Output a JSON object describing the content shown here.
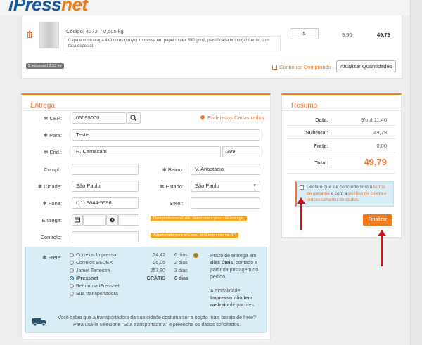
{
  "header": {
    "logo_main": "iPress",
    "logo_accent": "net"
  },
  "cart": {
    "product_code": "Código: 4272 – 0,505 kg",
    "product_description": "Capa e contracapa 4x0 cores (cmyk) impressa em papel triplex 350 g/m2, plastificada brilho (só frente) com faca especial.",
    "quantity": "5",
    "unit_price": "9,96",
    "total_price": "49,79",
    "volumes_badge": "5 volumes | 2,53 kg",
    "continue_label": "Continuar Comprando",
    "update_label": "Atualizar Quantidades",
    "icons": {
      "trash": "trash-icon",
      "cart": "cart-icon"
    }
  },
  "entrega": {
    "title": "Entrega",
    "cep_label": "CEP:",
    "cep_value": "05095000",
    "enderecos_label": "Endereços Cadastrados",
    "para_label": "Para:",
    "para_value": "Teste",
    "end_label": "End.:",
    "end_value": "R. Camacam",
    "numero_value": "399",
    "compl_label": "Compl.:",
    "compl_value": "",
    "bairro_label": "Bairro:",
    "bairro_value": "V. Anastácio",
    "cidade_label": "Cidade:",
    "cidade_value": "São Paulo",
    "estado_label": "Estado:",
    "estado_value": "São Paulo",
    "fone_label": "Fone:",
    "fone_value": "(11) 3644-5596",
    "setor_label": "Setor:",
    "setor_value": "",
    "entrega_label": "Entrega:",
    "entrega_tip": "Data preferencial, não determina o prazo de entrega.",
    "controle_label": "Controle:",
    "controle_tip": "Algum dado para seu uso, será impresso na NF"
  },
  "frete": {
    "label": "Frete:",
    "options": [
      {
        "name": "Correios Impresso",
        "price": "34,42",
        "days": "6 dias",
        "selected": false
      },
      {
        "name": "Correios SEDEX",
        "price": "25,05",
        "days": "2 dias",
        "selected": false
      },
      {
        "name": "Jamef Terrestre",
        "price": "257,80",
        "days": "3 dias",
        "selected": false
      },
      {
        "name": "iPressnet",
        "price": "GRÁTIS",
        "days": "6 dias",
        "selected": true
      },
      {
        "name": "Retirar na iPressnet",
        "price": "",
        "days": "",
        "selected": false
      },
      {
        "name": "Sua transportadora",
        "price": "",
        "days": "",
        "selected": false
      }
    ],
    "info_1": "Prazo de entrega em",
    "info_2": "dias úteis",
    "info_3": ", contado a partir da postagem do pedido.",
    "info_4": "A modalidade",
    "info_5": "Impresso não tem rastreio",
    "info_6": " de pacotes.",
    "truck_line_1": "Você sabia que a transportadora da sua cidade costuma ser a opção mais barata de frete?",
    "truck_line_2": "Para usá-la selecione \"Sua transportadora\" e preencha os dados solicitados."
  },
  "resumo": {
    "title": "Resumo",
    "data_label": "Data:",
    "data_value": "9/out 11:46",
    "subtotal_label": "Subtotal:",
    "subtotal_value": "49,79",
    "frete_label": "Frete:",
    "frete_value": "0,00",
    "total_label": "Total:",
    "total_value": "49,79",
    "terms_1": "Declaro que li e concordo com o ",
    "terms_link_1": "termo de garantia",
    "terms_2": " e com a ",
    "terms_link_2": "política de coleta e processamento de dados",
    "terms_3": ".",
    "finalizar_label": "Finalizar"
  },
  "colors": {
    "accent": "#f07b1a",
    "brand_blue": "#1a5c9b",
    "info_bg": "#d9edf7",
    "annotation_red": "#d0101a"
  }
}
